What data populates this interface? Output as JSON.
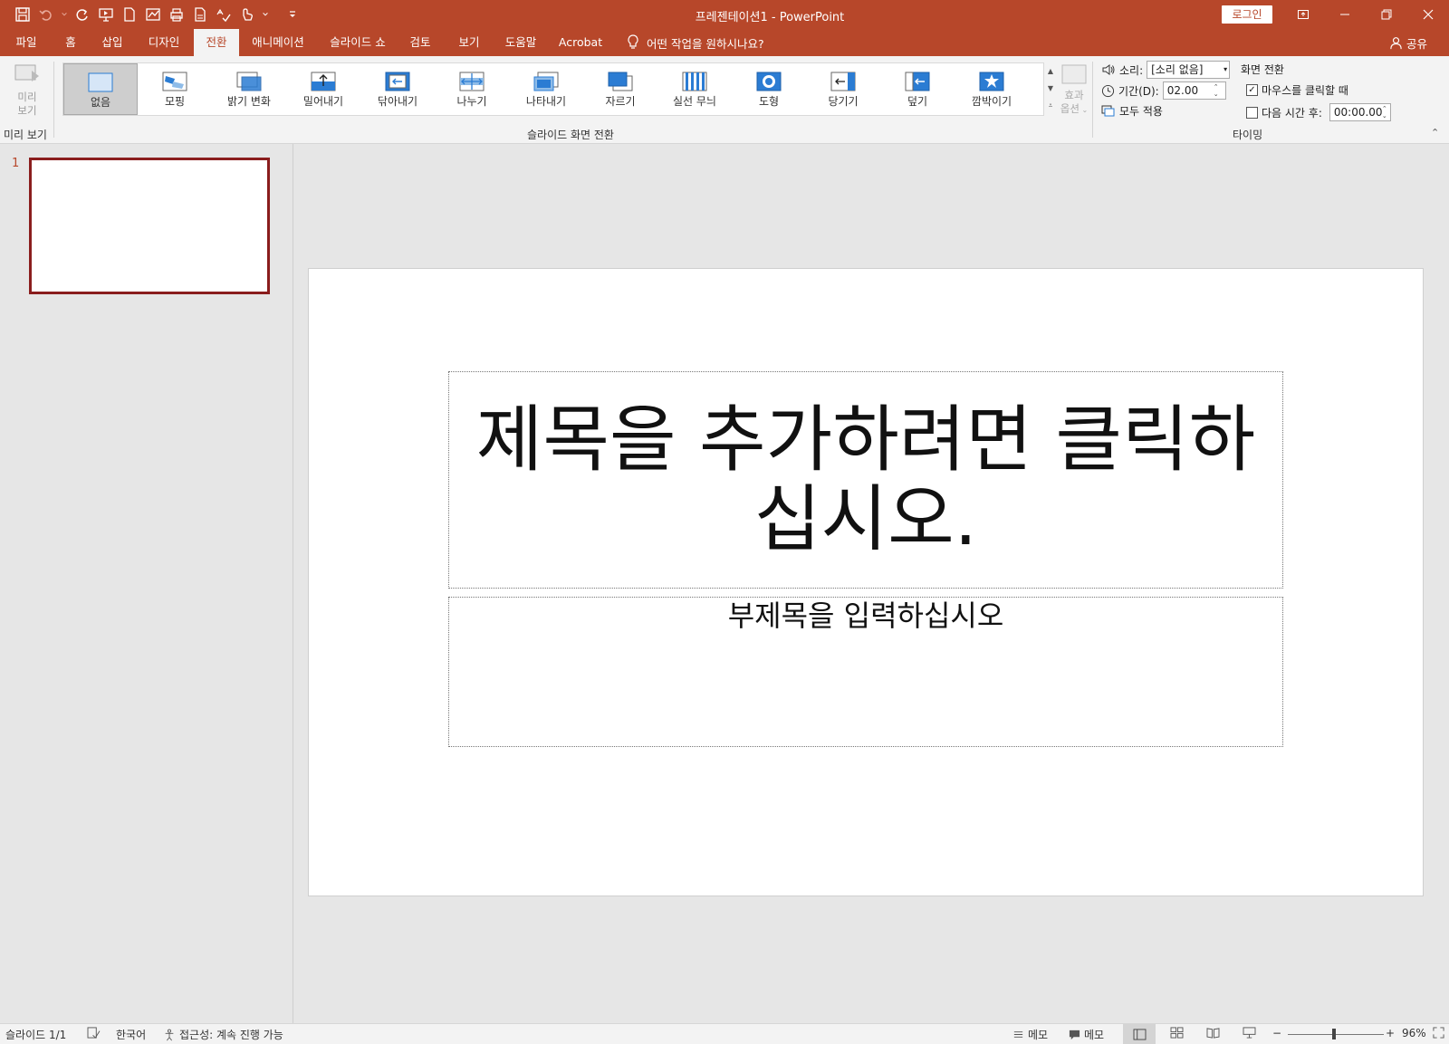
{
  "window": {
    "title": "프레젠테이션1  -  PowerPoint",
    "login_label": "로그인"
  },
  "tabs": [
    {
      "label": "파일"
    },
    {
      "label": "홈"
    },
    {
      "label": "삽입"
    },
    {
      "label": "디자인"
    },
    {
      "label": "전환"
    },
    {
      "label": "애니메이션"
    },
    {
      "label": "슬라이드 쇼"
    },
    {
      "label": "검토"
    },
    {
      "label": "보기"
    },
    {
      "label": "도움말"
    },
    {
      "label": "Acrobat"
    }
  ],
  "active_tab": "전환",
  "tell_me": "어떤 작업을 원하시나요?",
  "share_label": "공유",
  "ribbon": {
    "preview": {
      "button_label_1": "미리",
      "button_label_2": "보기",
      "group_label": "미리 보기"
    },
    "transitions": {
      "group_label": "슬라이드 화면 전환",
      "items": [
        {
          "label": "없음",
          "icon": "none-transition-icon"
        },
        {
          "label": "모핑",
          "icon": "morph-transition-icon"
        },
        {
          "label": "밝기 변화",
          "icon": "fade-transition-icon"
        },
        {
          "label": "밀어내기",
          "icon": "push-transition-icon"
        },
        {
          "label": "닦아내기",
          "icon": "wipe-transition-icon"
        },
        {
          "label": "나누기",
          "icon": "split-transition-icon"
        },
        {
          "label": "나타내기",
          "icon": "reveal-transition-icon"
        },
        {
          "label": "자르기",
          "icon": "cut-transition-icon"
        },
        {
          "label": "실선 무늬",
          "icon": "random-bars-transition-icon"
        },
        {
          "label": "도형",
          "icon": "shape-transition-icon"
        },
        {
          "label": "당기기",
          "icon": "uncover-transition-icon"
        },
        {
          "label": "덮기",
          "icon": "cover-transition-icon"
        },
        {
          "label": "깜박이기",
          "icon": "flash-transition-icon"
        }
      ],
      "selected": "없음",
      "effect_label_1": "효과",
      "effect_label_2": "옵션"
    },
    "timing": {
      "group_label": "타이밍",
      "sound_label": "소리:",
      "sound_value": "[소리 없음]",
      "duration_label": "기간(D):",
      "duration_value": "02.00",
      "apply_all_label": "모두 적용",
      "advance_label": "화면 전환",
      "on_click_label": "마우스를 클릭할 때",
      "on_click_checked": true,
      "after_label": "다음 시간 후:",
      "after_checked": false,
      "after_value": "00:00.00"
    }
  },
  "thumbnails": [
    {
      "number": "1"
    }
  ],
  "slide": {
    "title_placeholder": "제목을 추가하려면 클릭하십시오.",
    "subtitle_placeholder": "부제목을 입력하십시오"
  },
  "status": {
    "slide_count": "슬라이드 1/1",
    "language": "한국어",
    "accessibility": "접근성: 계속 진행 가능",
    "notes_label": "메모",
    "comments_label": "메모",
    "zoom": "96%",
    "zoom_fraction": 0.48
  },
  "colors": {
    "accent": "#b7472a",
    "thumb_border": "#8a1d1d",
    "transition_icon": "#2b7cd3"
  }
}
